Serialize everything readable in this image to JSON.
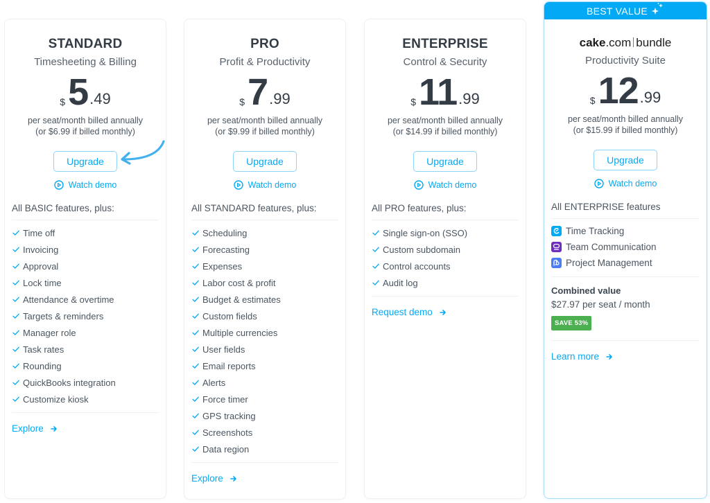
{
  "plans": [
    {
      "name": "STANDARD",
      "subtitle": "Timesheeting & Billing",
      "currency": "$",
      "price_int": "5",
      "price_dec": ".49",
      "billing_line1": "per seat/month billed annually",
      "billing_line2": "(or $6.99 if billed monthly)",
      "upgrade_label": "Upgrade",
      "watch_demo_label": "Watch demo",
      "features_head": "All BASIC features, plus:",
      "features": [
        "Time off",
        "Invoicing",
        "Approval",
        "Lock time",
        "Attendance & overtime",
        "Targets & reminders",
        "Manager role",
        "Task rates",
        "Rounding",
        "QuickBooks integration",
        "Customize kiosk"
      ],
      "link_label": "Explore"
    },
    {
      "name": "PRO",
      "subtitle": "Profit & Productivity",
      "currency": "$",
      "price_int": "7",
      "price_dec": ".99",
      "billing_line1": "per seat/month billed annually",
      "billing_line2": "(or $9.99 if billed monthly)",
      "upgrade_label": "Upgrade",
      "watch_demo_label": "Watch demo",
      "features_head": "All STANDARD features, plus:",
      "features": [
        "Scheduling",
        "Forecasting",
        "Expenses",
        "Labor cost & profit",
        "Budget & estimates",
        "Custom fields",
        "Multiple currencies",
        "User fields",
        "Email reports",
        "Alerts",
        "Force timer",
        "GPS tracking",
        "Screenshots",
        "Data region"
      ],
      "link_label": "Explore"
    },
    {
      "name": "ENTERPRISE",
      "subtitle": "Control & Security",
      "currency": "$",
      "price_int": "11",
      "price_dec": ".99",
      "billing_line1": "per seat/month billed annually",
      "billing_line2": "(or $14.99 if billed monthly)",
      "upgrade_label": "Upgrade",
      "watch_demo_label": "Watch demo",
      "features_head": "All PRO features, plus:",
      "features": [
        "Single sign-on (SSO)",
        "Custom subdomain",
        "Control accounts",
        "Audit log"
      ],
      "link_label": "Request demo"
    }
  ],
  "bundle": {
    "banner": "BEST VALUE",
    "logo_cake": "cake",
    "logo_com": ".com",
    "logo_bundle": "bundle",
    "subtitle": "Productivity Suite",
    "currency": "$",
    "price_int": "12",
    "price_dec": ".99",
    "billing_line1": "per seat/month billed annually",
    "billing_line2": "(or $15.99 if billed monthly)",
    "upgrade_label": "Upgrade",
    "watch_demo_label": "Watch demo",
    "features_head": "All ENTERPRISE features",
    "apps": [
      {
        "label": "Time Tracking",
        "icon": "time-tracking-icon",
        "color": "#03a9f4"
      },
      {
        "label": "Team Communication",
        "icon": "team-communication-icon",
        "color": "#6f2dbd"
      },
      {
        "label": "Project Management",
        "icon": "project-management-icon",
        "color": "#4a7cf5"
      }
    ],
    "combined_label": "Combined value",
    "combined_value": "$27.97 per seat / month",
    "save_badge": "SAVE 53%",
    "link_label": "Learn more"
  },
  "colors": {
    "accent": "#03a9f4",
    "save_green": "#4caf50",
    "text_dark": "#333c45"
  }
}
